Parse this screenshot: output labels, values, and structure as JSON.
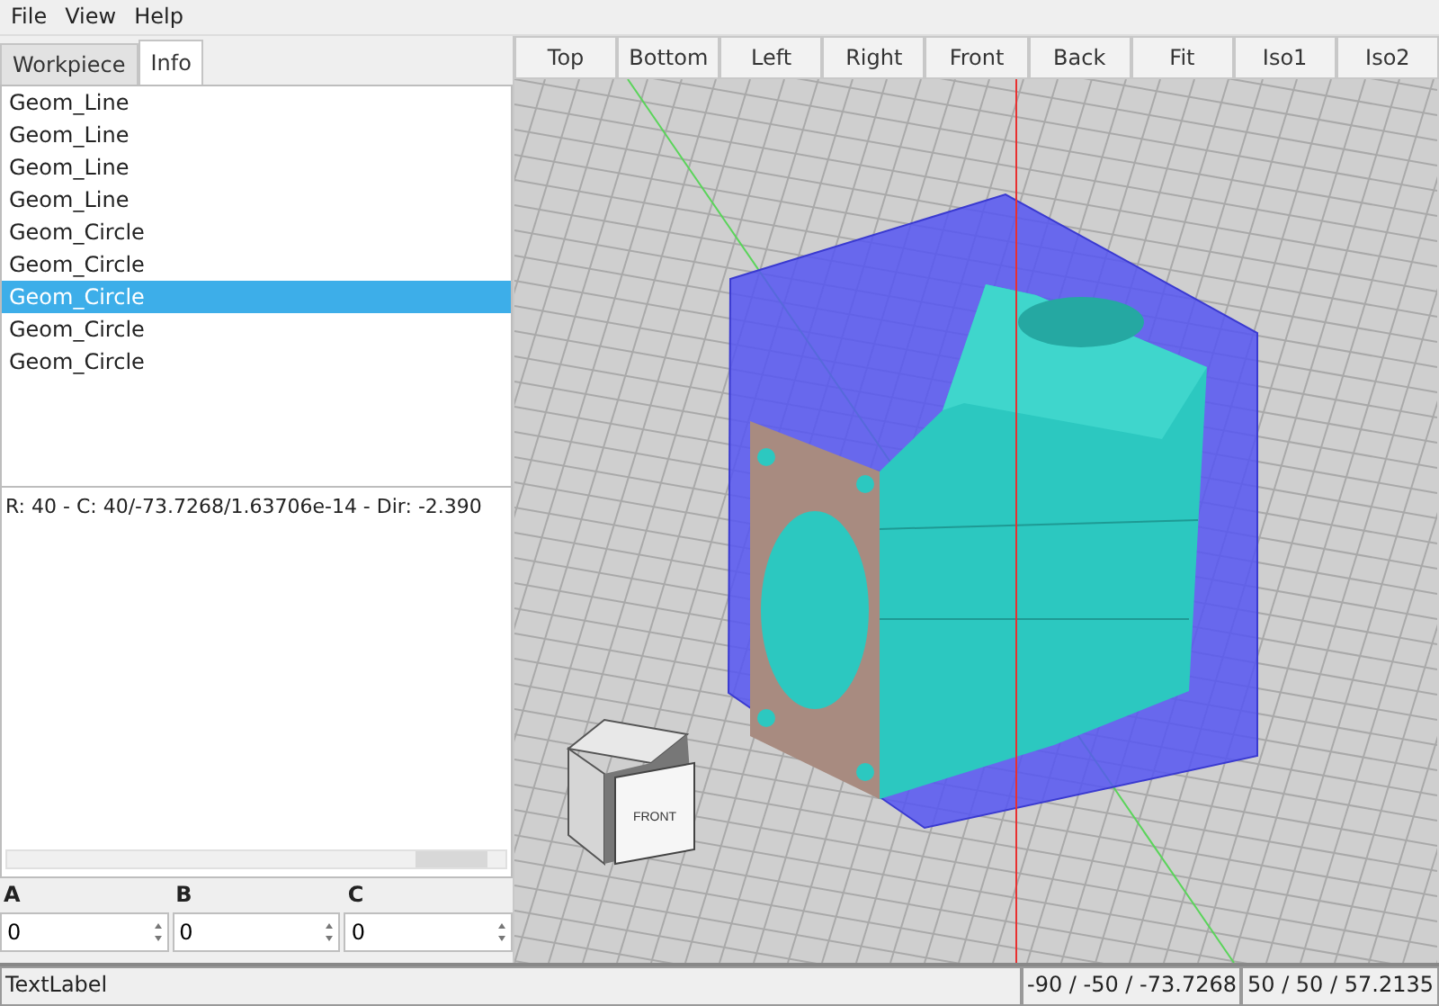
{
  "menu": [
    "File",
    "View",
    "Help"
  ],
  "tabs": [
    {
      "label": "Workpiece",
      "selected": false
    },
    {
      "label": "Info",
      "selected": true
    }
  ],
  "list_items": [
    {
      "label": "Geom_Line",
      "selected": false
    },
    {
      "label": "Geom_Line",
      "selected": false
    },
    {
      "label": "Geom_Line",
      "selected": false
    },
    {
      "label": "Geom_Line",
      "selected": false
    },
    {
      "label": "Geom_Circle",
      "selected": false
    },
    {
      "label": "Geom_Circle",
      "selected": false
    },
    {
      "label": "Geom_Circle",
      "selected": true
    },
    {
      "label": "Geom_Circle",
      "selected": false
    },
    {
      "label": "Geom_Circle",
      "selected": false
    }
  ],
  "info_text": "R: 40 - C: 40/-73.7268/1.63706e-14 - Dir: -2.390",
  "fields": [
    {
      "label": "A",
      "value": "0"
    },
    {
      "label": "B",
      "value": "0"
    },
    {
      "label": "C",
      "value": "0"
    }
  ],
  "view_buttons": [
    "Top",
    "Bottom",
    "Left",
    "Right",
    "Front",
    "Back",
    "Fit",
    "Iso1",
    "Iso2"
  ],
  "view_cube": {
    "front_label": "FRONT"
  },
  "status_bar": {
    "label": "TextLabel",
    "coords_1": "-90 / -50 / -73.7268",
    "coords_2": "50 / 50 / 57.2135"
  }
}
